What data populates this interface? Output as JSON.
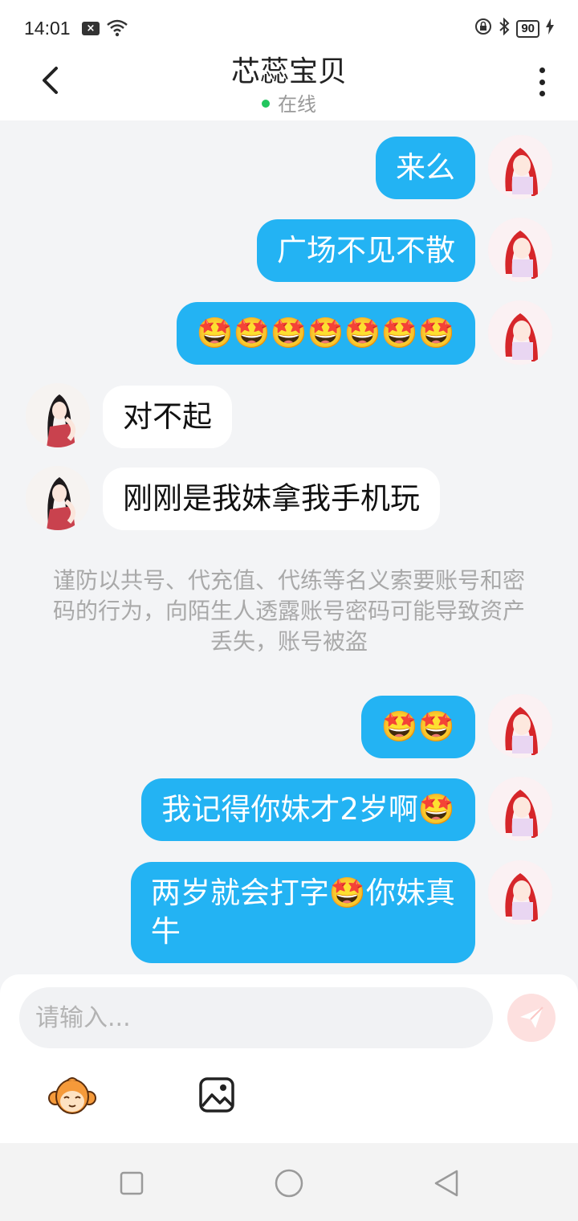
{
  "status_bar": {
    "time": "14:01",
    "battery": "90"
  },
  "header": {
    "title": "芯蕊宝贝",
    "status": "在线",
    "status_color": "#22c55e"
  },
  "messages": [
    {
      "from": "me",
      "text": "来么"
    },
    {
      "from": "me",
      "text": "广场不见不散"
    },
    {
      "from": "me",
      "text": "🤩🤩🤩🤩🤩🤩🤩"
    },
    {
      "from": "her",
      "text": "对不起"
    },
    {
      "from": "her",
      "text": "刚刚是我妹拿我手机玩"
    },
    {
      "from": "me",
      "text": "🤩🤩"
    },
    {
      "from": "me",
      "text": "我记得你妹才2岁啊🤩"
    },
    {
      "from": "me",
      "text": "两岁就会打字🤩你妹真\n牛"
    }
  ],
  "notice": "谨防以共号、代充值、代练等名义索要账号和密码的行为，向陌生人透露账号密码可能导致资产丢失，账号被盗",
  "input": {
    "placeholder": "请输入..."
  },
  "colors": {
    "my_bubble": "#23b3f3",
    "her_bubble": "#ffffff",
    "send_button": "#fde0df"
  },
  "icons": [
    "back-arrow-icon",
    "more-icon",
    "send-icon",
    "monkey-emoji-icon",
    "image-icon",
    "square-nav-icon",
    "circle-nav-icon",
    "triangle-nav-icon"
  ]
}
